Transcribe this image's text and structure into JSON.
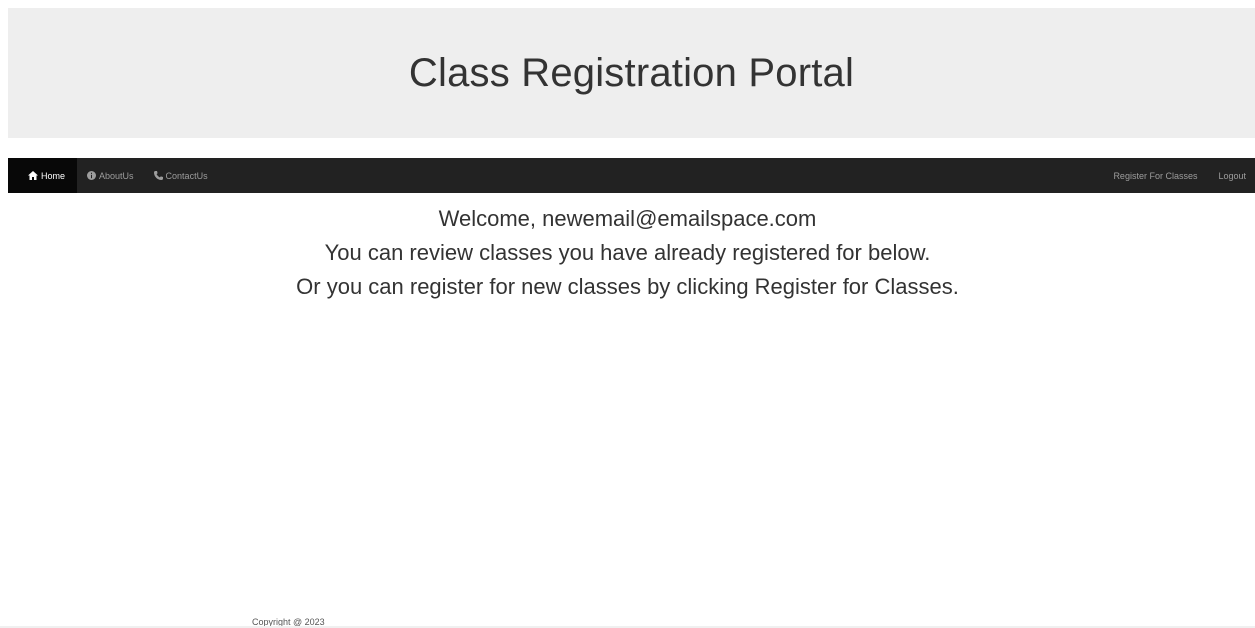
{
  "header": {
    "title": "Class Registration Portal"
  },
  "navbar": {
    "left_items": [
      {
        "label": "Home",
        "icon": "home-icon",
        "active": true
      },
      {
        "label": "AboutUs",
        "icon": "info-icon",
        "active": false
      },
      {
        "label": "ContactUs",
        "icon": "phone-icon",
        "active": false
      }
    ],
    "right_items": [
      {
        "label": "Register For Classes"
      },
      {
        "label": "Logout"
      }
    ]
  },
  "main": {
    "welcome_line": "Welcome, newemail@emailspace.com",
    "review_line": "You can review classes you have already registered for below.",
    "register_line": "Or you can register for new classes by clicking Register for Classes."
  },
  "footer": {
    "copyright": "Copyright @ 2023"
  },
  "colors": {
    "jumbotron_bg": "#eeeeee",
    "navbar_bg": "#222222",
    "nav_active_bg": "#080808",
    "nav_text": "#9d9d9d"
  }
}
